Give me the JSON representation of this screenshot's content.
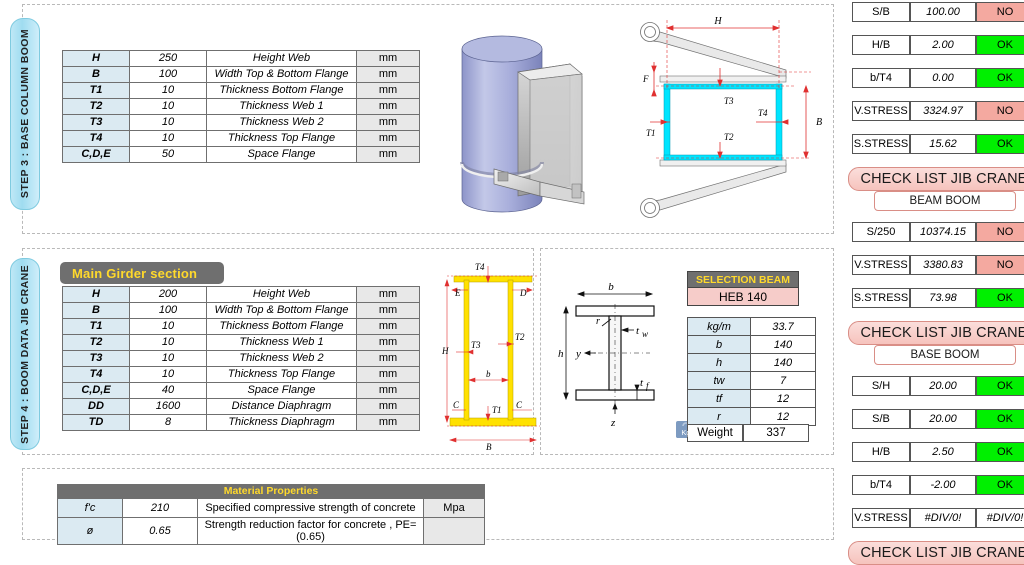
{
  "steps": {
    "step3_label": "STEP 3 : BASE COLUMN BOOM",
    "step4_label": "STEP 4 : BOOM DATA JIB CRANE"
  },
  "base_column_table": {
    "rows": [
      {
        "sym": "H",
        "val": "250",
        "desc": "Height Web",
        "unit": "mm"
      },
      {
        "sym": "B",
        "val": "100",
        "desc": "Width Top & Bottom  Flange",
        "unit": "mm"
      },
      {
        "sym": "T1",
        "val": "10",
        "desc": "Thickness Bottom Flange",
        "unit": "mm"
      },
      {
        "sym": "T2",
        "val": "10",
        "desc": "Thickness Web 1",
        "unit": "mm"
      },
      {
        "sym": "T3",
        "val": "10",
        "desc": "Thickness Web 2",
        "unit": "mm"
      },
      {
        "sym": "T4",
        "val": "10",
        "desc": "Thickness Top Flange",
        "unit": "mm"
      },
      {
        "sym": "C,D,E",
        "val": "50",
        "desc": "Space Flange",
        "unit": "mm"
      }
    ]
  },
  "main_girder": {
    "caption": "Main Girder section",
    "rows": [
      {
        "sym": "H",
        "val": "200",
        "desc": "Height Web",
        "unit": "mm"
      },
      {
        "sym": "B",
        "val": "100",
        "desc": "Width Top & Bottom  Flange",
        "unit": "mm"
      },
      {
        "sym": "T1",
        "val": "10",
        "desc": "Thickness Bottom Flange",
        "unit": "mm"
      },
      {
        "sym": "T2",
        "val": "10",
        "desc": "Thickness Web 1",
        "unit": "mm"
      },
      {
        "sym": "T3",
        "val": "10",
        "desc": "Thickness Web 2",
        "unit": "mm"
      },
      {
        "sym": "T4",
        "val": "10",
        "desc": "Thickness Top Flange",
        "unit": "mm"
      },
      {
        "sym": "C,D,E",
        "val": "40",
        "desc": "Space Flange",
        "unit": "mm"
      },
      {
        "sym": "DD",
        "val": "1600",
        "desc": "Distance Diaphragm",
        "unit": "mm"
      },
      {
        "sym": "TD",
        "val": "8",
        "desc": "Thickness Diaphragm",
        "unit": "mm"
      }
    ]
  },
  "material_properties": {
    "caption": "Material Properties",
    "rows": [
      {
        "sym": "f'c",
        "val": "210",
        "desc": "Specified compressive strength of concrete",
        "unit": "Mpa"
      },
      {
        "sym": "ø",
        "val": "0.65",
        "desc": "Strength reduction factor for concrete , PE= (0.65)",
        "unit": ""
      }
    ]
  },
  "selection_beam": {
    "header": "SELECTION BEAM",
    "value": "HEB 140",
    "props": [
      {
        "k": "kg/m",
        "v": "33.7"
      },
      {
        "k": "b",
        "v": "140"
      },
      {
        "k": "h",
        "v": "140"
      },
      {
        "k": "tw",
        "v": "7"
      },
      {
        "k": "tf",
        "v": "12"
      },
      {
        "k": "r",
        "v": "12"
      }
    ],
    "weight_label": "Weight",
    "weight_value": "337",
    "kg_icon_label": "Kg"
  },
  "checklist_top": {
    "rows": [
      {
        "label": "S/B",
        "value": "100.00",
        "status": "NO",
        "state": "no"
      },
      {
        "label": "H/B",
        "value": "2.00",
        "status": "OK",
        "state": "ok"
      },
      {
        "label": "b/T4",
        "value": "0.00",
        "status": "OK",
        "state": "ok"
      },
      {
        "label": "V.STRESS",
        "value": "3324.97",
        "status": "NO",
        "state": "no"
      },
      {
        "label": "S.STRESS",
        "value": "15.62",
        "status": "OK",
        "state": "ok"
      }
    ]
  },
  "checklist_beam_boom": {
    "banner": "CHECK LIST JIB CRANE",
    "sub": "BEAM BOOM",
    "rows": [
      {
        "label": "S/250",
        "value": "10374.15",
        "status": "NO",
        "state": "no"
      },
      {
        "label": "V.STRESS",
        "value": "3380.83",
        "status": "NO",
        "state": "no"
      },
      {
        "label": "S.STRESS",
        "value": "73.98",
        "status": "OK",
        "state": "ok"
      }
    ]
  },
  "checklist_base_boom": {
    "banner": "CHECK LIST JIB CRANE",
    "sub": "BASE BOOM",
    "rows": [
      {
        "label": "S/H",
        "value": "20.00",
        "status": "OK",
        "state": "ok"
      },
      {
        "label": "S/B",
        "value": "20.00",
        "status": "OK",
        "state": "ok"
      },
      {
        "label": "H/B",
        "value": "2.50",
        "status": "OK",
        "state": "ok"
      },
      {
        "label": "b/T4",
        "value": "-2.00",
        "status": "OK",
        "state": "ok"
      },
      {
        "label": "V.STRESS",
        "value": "#DIV/0!",
        "status": "#DIV/0!",
        "state": "err"
      }
    ]
  },
  "checklist_bottom": {
    "banner": "CHECK LIST JIB CRANE"
  },
  "drawings": {
    "base_section_dims": [
      "H",
      "B",
      "F",
      "T1",
      "T2",
      "T3",
      "T4"
    ],
    "girder_section_dims": [
      "H",
      "B",
      "b",
      "C",
      "D",
      "E",
      "T1",
      "T2",
      "T3",
      "T4"
    ],
    "ibeam_dims": [
      "b",
      "h",
      "tw",
      "tf",
      "r",
      "y",
      "z"
    ]
  },
  "colors": {
    "ok": "#00f000",
    "no": "#f4a9a0",
    "label_blue": "#dbeaf2",
    "caption_gray": "#6f6f6f",
    "caption_yellow": "#ffd92b",
    "section_cyan": "#00e5ff",
    "girder_yellow": "#ffe100"
  }
}
